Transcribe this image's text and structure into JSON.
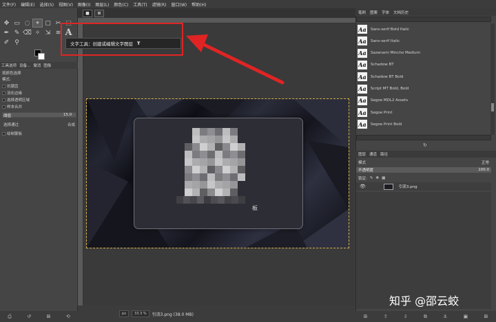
{
  "menubar": [
    "文件(F)",
    "编辑(E)",
    "选择(S)",
    "视图(V)",
    "图像(I)",
    "图层(L)",
    "颜色(C)",
    "工具(T)",
    "滤镜(R)",
    "窗口(W)",
    "帮助(H)"
  ],
  "toolbox": {
    "row1": [
      "✥",
      "▭",
      "◌",
      "⌖",
      "▢",
      "✂",
      "⬚"
    ],
    "row2": [
      "✒",
      "✎",
      "⌫",
      "✧",
      "⇲",
      "≋",
      "A"
    ],
    "row3": [
      "✐",
      "⚲"
    ]
  },
  "tool_tabs": [
    "工具选项",
    "设备...",
    "撤消",
    "图像"
  ],
  "tool_options": {
    "title": "按颜色选择",
    "mode_label": "模式:",
    "antialias": "抗锯齿",
    "feather_edges": "羽化边缘",
    "select_transparent": "选择透明区域",
    "sample_merged": "样本合并",
    "threshold_label": "阈值",
    "threshold_value": "15.0",
    "select_by_label": "选择通过",
    "select_by_value": "合成",
    "draw_mask": "绘制蒙板"
  },
  "image_tabs": [
    "■",
    "⊠"
  ],
  "tooltip": {
    "text": "文字工具：创建或编辑文字图层",
    "shortcut": "T"
  },
  "card_text": "板",
  "status": {
    "unit": "px",
    "zoom": "33.3 %",
    "text": "引流3.png (38.0 MB)"
  },
  "dock_tabs": [
    "笔刷",
    "图案",
    "字体",
    "文档历史"
  ],
  "fonts": [
    {
      "glyph": "Aa",
      "name": "Sans-serif Bold Italic"
    },
    {
      "glyph": "Aa",
      "name": "Sans-serif Italic"
    },
    {
      "glyph": "Aa",
      "name": "Sazanami Mincho Medium"
    },
    {
      "glyph": "Aa",
      "name": "Schadow BT"
    },
    {
      "glyph": "Aa",
      "name": "Schadow BT Bold"
    },
    {
      "glyph": "Aa",
      "name": "Script MT Bold, Bold"
    },
    {
      "glyph": "Aa",
      "name": "Segoe MDL2 Assets"
    },
    {
      "glyph": "Aa",
      "name": "Segoe Print"
    },
    {
      "glyph": "Aa",
      "name": "Segoe Print Bold"
    }
  ],
  "layer_tabs": [
    "图层",
    "通道",
    "路径"
  ],
  "layers": {
    "mode_label": "模式",
    "mode_value": "正常",
    "opacity_label": "不透明度",
    "opacity_value": "100.0",
    "lock_label": "锁定:",
    "layer_name": "引流3.png"
  },
  "watermark": "知乎 @邵云蛟",
  "colors": {
    "accent_red": "#e02424",
    "selection": "#d8b04a"
  }
}
